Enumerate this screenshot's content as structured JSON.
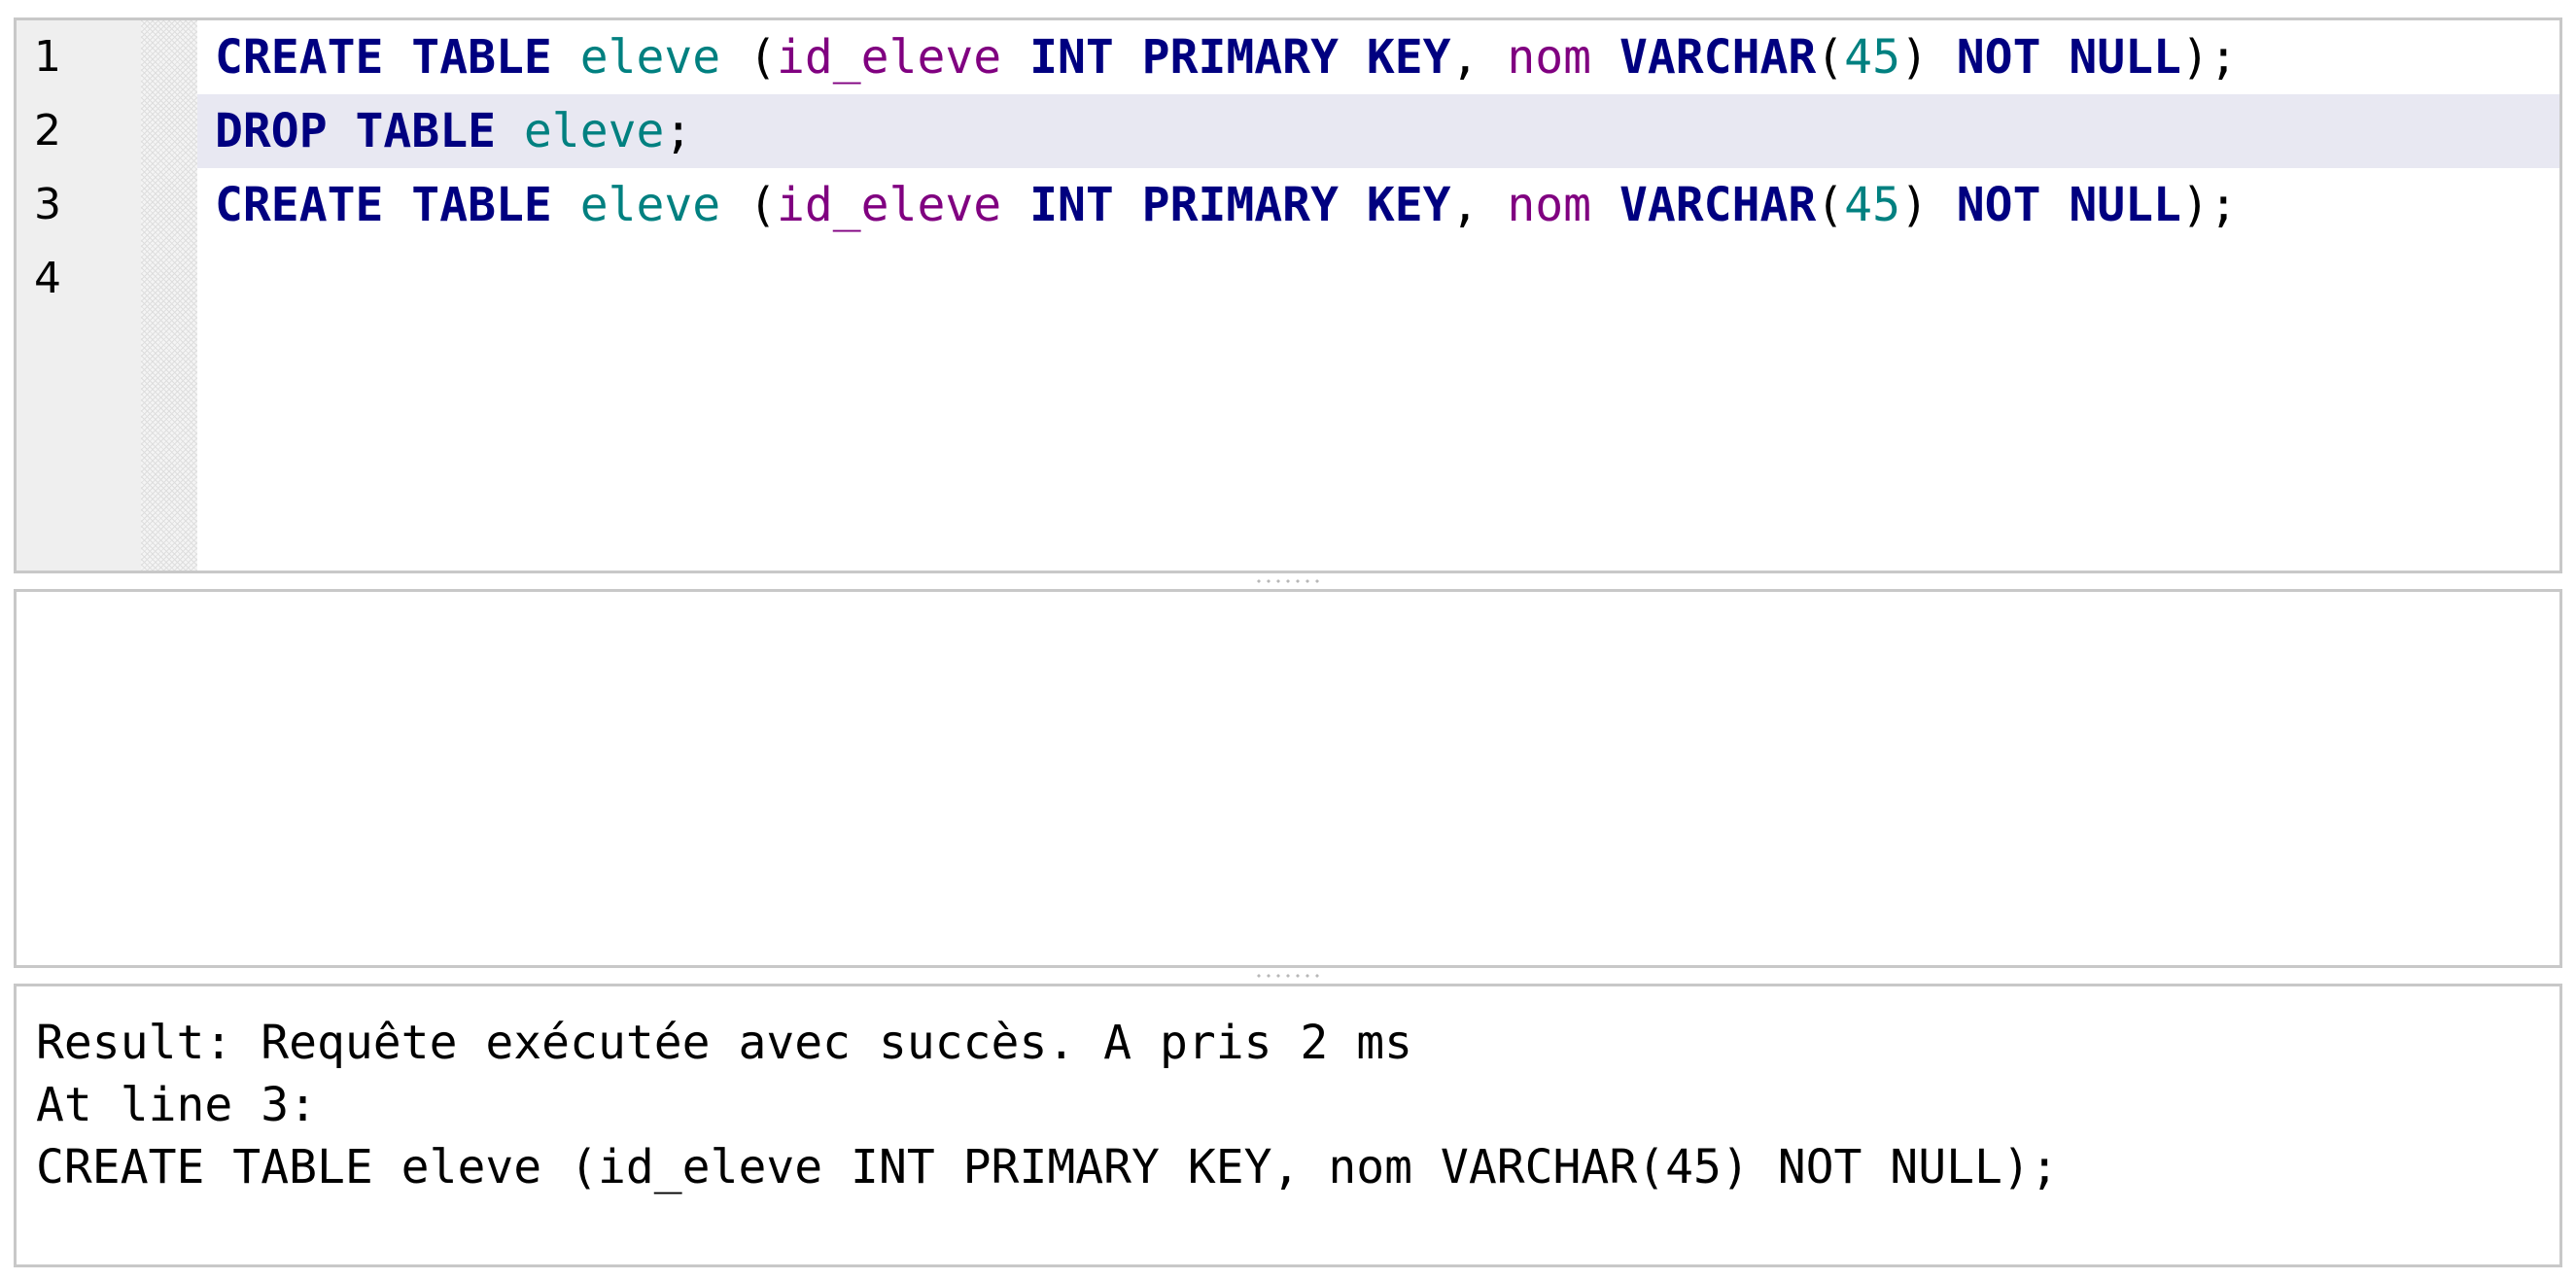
{
  "editor": {
    "lines": [
      {
        "number": "1",
        "tokens": [
          {
            "t": "CREATE TABLE",
            "c": "kw"
          },
          {
            "t": " ",
            "c": "punct"
          },
          {
            "t": "eleve",
            "c": "ident"
          },
          {
            "t": " (",
            "c": "punct"
          },
          {
            "t": "id_eleve",
            "c": "col"
          },
          {
            "t": " ",
            "c": "punct"
          },
          {
            "t": "INT PRIMARY KEY",
            "c": "kw"
          },
          {
            "t": ", ",
            "c": "punct"
          },
          {
            "t": "nom",
            "c": "col"
          },
          {
            "t": " ",
            "c": "punct"
          },
          {
            "t": "VARCHAR",
            "c": "kw"
          },
          {
            "t": "(",
            "c": "punct"
          },
          {
            "t": "45",
            "c": "num"
          },
          {
            "t": ") ",
            "c": "punct"
          },
          {
            "t": "NOT NULL",
            "c": "kw"
          },
          {
            "t": ");",
            "c": "punct"
          }
        ]
      },
      {
        "number": "2",
        "current": true,
        "tokens": [
          {
            "t": "DROP TABLE",
            "c": "kw"
          },
          {
            "t": " ",
            "c": "punct"
          },
          {
            "t": "eleve",
            "c": "ident"
          },
          {
            "t": ";",
            "c": "punct"
          }
        ]
      },
      {
        "number": "3",
        "tokens": [
          {
            "t": "CREATE TABLE",
            "c": "kw"
          },
          {
            "t": " ",
            "c": "punct"
          },
          {
            "t": "eleve",
            "c": "ident"
          },
          {
            "t": " (",
            "c": "punct"
          },
          {
            "t": "id_eleve",
            "c": "col"
          },
          {
            "t": " ",
            "c": "punct"
          },
          {
            "t": "INT PRIMARY KEY",
            "c": "kw"
          },
          {
            "t": ", ",
            "c": "punct"
          },
          {
            "t": "nom",
            "c": "col"
          },
          {
            "t": " ",
            "c": "punct"
          },
          {
            "t": "VARCHAR",
            "c": "kw"
          },
          {
            "t": "(",
            "c": "punct"
          },
          {
            "t": "45",
            "c": "num"
          },
          {
            "t": ") ",
            "c": "punct"
          },
          {
            "t": "NOT NULL",
            "c": "kw"
          },
          {
            "t": ");",
            "c": "punct"
          }
        ]
      },
      {
        "number": "4",
        "tokens": []
      }
    ]
  },
  "messages": {
    "lines": [
      "Result: Requête exécutée avec succès. A pris 2 ms",
      "At line 3:",
      "CREATE TABLE eleve (id_eleve INT PRIMARY KEY, nom VARCHAR(45) NOT NULL);"
    ]
  },
  "colors": {
    "keyword": "#000080",
    "identifier": "#008080",
    "column": "#800080",
    "number": "#008080",
    "current_line": "#e8e8f2",
    "gutter": "#efefef",
    "border": "#c8c8c8"
  }
}
